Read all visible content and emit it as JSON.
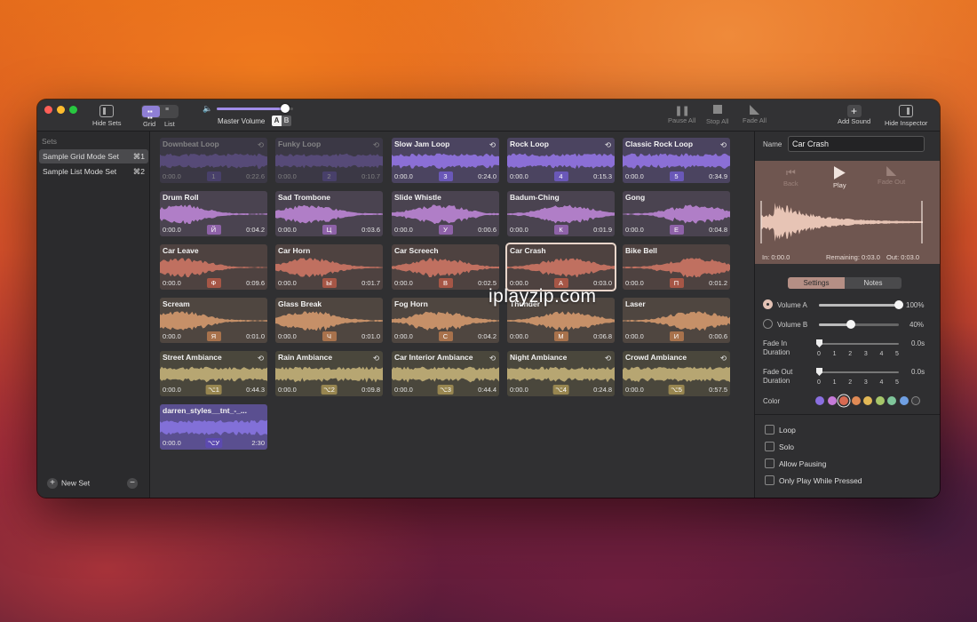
{
  "toolbar": {
    "hide_sets": "Hide Sets",
    "grid": "Grid",
    "list": "List",
    "master_volume": "Master Volume",
    "master_volume_level": 0.9,
    "ab_a": "A",
    "ab_b": "B",
    "pause_all": "Pause All",
    "stop_all": "Stop All",
    "fade_all": "Fade All",
    "add_sound": "Add Sound",
    "hide_inspector": "Hide Inspector"
  },
  "sidebar": {
    "header": "Sets",
    "items": [
      {
        "label": "Sample Grid Mode Set",
        "shortcut": "⌘1"
      },
      {
        "label": "Sample List Mode Set",
        "shortcut": "⌘2"
      }
    ],
    "new_set": "New Set"
  },
  "tiles": [
    {
      "name": "Downbeat Loop",
      "start": "0:00.0",
      "end": "0:22.6",
      "key": "1",
      "loop": true,
      "group": "purple",
      "dim": true
    },
    {
      "name": "Funky Loop",
      "start": "0:00.0",
      "end": "0:10.7",
      "key": "2",
      "loop": true,
      "group": "purple",
      "dim": true
    },
    {
      "name": "Slow Jam Loop",
      "start": "0:00.0",
      "end": "0:24.0",
      "key": "3",
      "loop": true,
      "group": "purple"
    },
    {
      "name": "Rock Loop",
      "start": "0:00.0",
      "end": "0:15.3",
      "key": "4",
      "loop": true,
      "group": "purple"
    },
    {
      "name": "Classic Rock Loop",
      "start": "0:00.0",
      "end": "0:34.9",
      "key": "5",
      "loop": true,
      "group": "purple"
    },
    {
      "name": "Drum Roll",
      "start": "0:00.0",
      "end": "0:04.2",
      "key": "Й",
      "group": "mauve"
    },
    {
      "name": "Sad Trombone",
      "start": "0:00.0",
      "end": "0:03.6",
      "key": "Ц",
      "group": "mauve"
    },
    {
      "name": "Slide Whistle",
      "start": "0:00.0",
      "end": "0:00.6",
      "key": "У",
      "group": "mauve"
    },
    {
      "name": "Badum-Ching",
      "start": "0:00.0",
      "end": "0:01.9",
      "key": "К",
      "group": "mauve"
    },
    {
      "name": "Gong",
      "start": "0:00.0",
      "end": "0:04.8",
      "key": "Е",
      "group": "mauve"
    },
    {
      "name": "Car Leave",
      "start": "0:00.0",
      "end": "0:09.6",
      "key": "Ф",
      "group": "red"
    },
    {
      "name": "Car Horn",
      "start": "0:00.0",
      "end": "0:01.7",
      "key": "Ы",
      "group": "red"
    },
    {
      "name": "Car Screech",
      "start": "0:00.0",
      "end": "0:02.5",
      "key": "В",
      "group": "red"
    },
    {
      "name": "Car Crash",
      "start": "0:00.0",
      "end": "0:03.0",
      "key": "А",
      "group": "red",
      "selected": true
    },
    {
      "name": "Bike Bell",
      "start": "0:00.0",
      "end": "0:01.2",
      "key": "П",
      "group": "red"
    },
    {
      "name": "Scream",
      "start": "0:00.0",
      "end": "0:01.0",
      "key": "Я",
      "group": "orange"
    },
    {
      "name": "Glass Break",
      "start": "0:00.0",
      "end": "0:01.0",
      "key": "Ч",
      "group": "orange"
    },
    {
      "name": "Fog Horn",
      "start": "0:00.0",
      "end": "0:04.2",
      "key": "С",
      "group": "orange"
    },
    {
      "name": "Thunder",
      "start": "0:00.0",
      "end": "0:06.8",
      "key": "М",
      "group": "orange"
    },
    {
      "name": "Laser",
      "start": "0:00.0",
      "end": "0:00.6",
      "key": "И",
      "group": "orange"
    },
    {
      "name": "Street Ambiance",
      "start": "0:00.0",
      "end": "0:44.3",
      "key": "⌥1",
      "loop": true,
      "group": "olive"
    },
    {
      "name": "Rain Ambiance",
      "start": "0:00.0",
      "end": "0:09.8",
      "key": "⌥2",
      "loop": true,
      "group": "olive"
    },
    {
      "name": "Car Interior Ambiance",
      "start": "0:00.0",
      "end": "0:44.4",
      "key": "⌥3",
      "loop": true,
      "group": "olive"
    },
    {
      "name": "Night Ambiance",
      "start": "0:00.0",
      "end": "0:24.8",
      "key": "⌥4",
      "loop": true,
      "group": "olive"
    },
    {
      "name": "Crowd Ambiance",
      "start": "0:00.0",
      "end": "0:57.5",
      "key": "⌥5",
      "loop": true,
      "group": "olive"
    },
    {
      "name": "darren_styles__tnt_-_...",
      "start": "0:00.0",
      "end": "2:30",
      "key": "⌥У",
      "group": "violet"
    }
  ],
  "group_colors": {
    "purple": {
      "bg": "#4b4460",
      "wave": "#8b6fd6",
      "key": "#6a58b8"
    },
    "mauve": {
      "bg": "#4a4350",
      "wave": "#b07ec7",
      "key": "#8e62a8"
    },
    "red": {
      "bg": "#4e4240",
      "wave": "#c07060",
      "key": "#a65646"
    },
    "orange": {
      "bg": "#4f4640",
      "wave": "#c69068",
      "key": "#a8724c"
    },
    "olive": {
      "bg": "#4a473c",
      "wave": "#b7a672",
      "key": "#988650"
    },
    "violet": {
      "bg": "#5a4f90",
      "wave": "#8270d8",
      "key": "#5c4ab0"
    }
  },
  "inspector": {
    "name_label": "Name",
    "name_value": "Car Crash",
    "back": "Back",
    "play": "Play",
    "fade_out": "Fade Out",
    "in_time": "In: 0:00.0",
    "remaining": "Remaining: 0:03.0",
    "out_time": "Out: 0:03.0",
    "tab_settings": "Settings",
    "tab_notes": "Notes",
    "volume_a": "Volume A",
    "volume_a_value": "100%",
    "volume_a_level": 1.0,
    "volume_b": "Volume B",
    "volume_b_value": "40%",
    "volume_b_level": 0.4,
    "fade_in_label": "Fade In Duration",
    "fade_in_value": "0.0s",
    "fade_out_label": "Fade Out Duration",
    "fade_out_value": "0.0s",
    "scale": [
      "0",
      "1",
      "2",
      "3",
      "4",
      "5"
    ],
    "color_label": "Color",
    "colors": [
      "#8a6fe0",
      "#c57ad8",
      "#d86a52",
      "#e08a55",
      "#e2b856",
      "#a7c76a",
      "#7fc59a",
      "#6f9fe2",
      "#3a3a3c"
    ],
    "selected_color": 2,
    "loop": "Loop",
    "solo": "Solo",
    "allow_pausing": "Allow Pausing",
    "only_play_pressed": "Only Play While Pressed"
  },
  "watermark": "iplayzip.com"
}
